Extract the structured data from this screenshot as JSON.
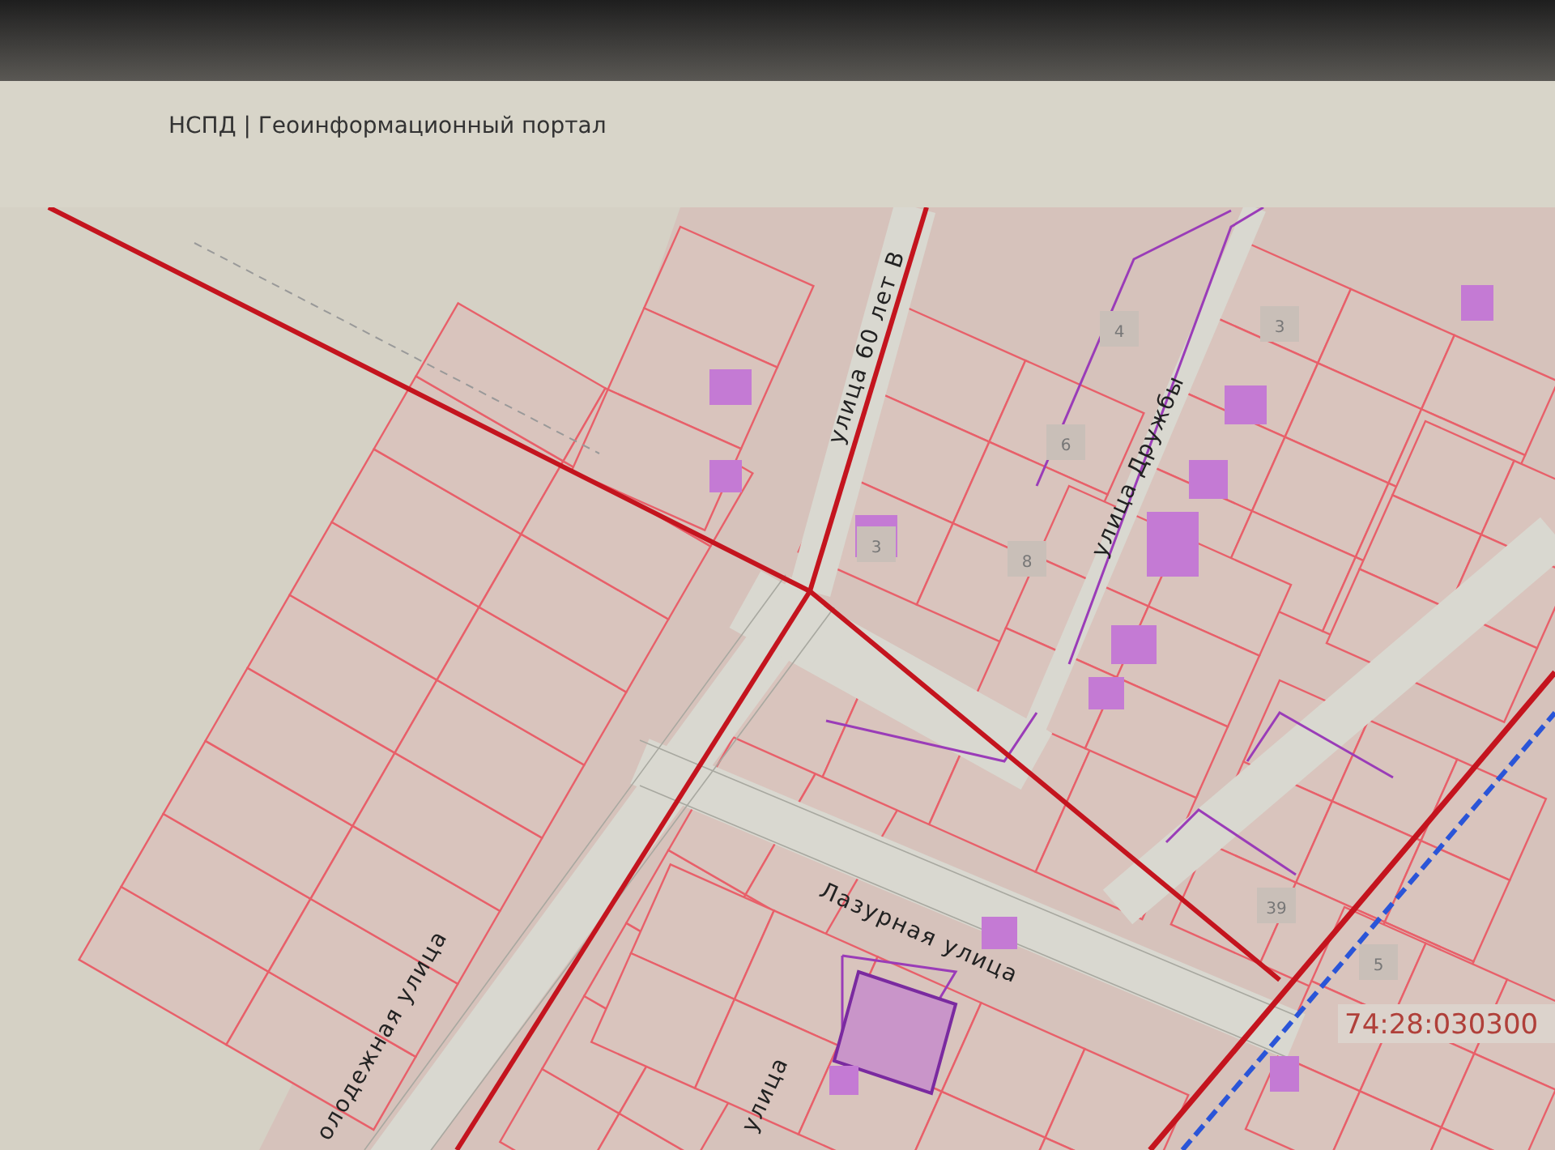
{
  "header": {
    "title": "НСПД | Геоинформационный портал"
  },
  "map": {
    "street_labels": [
      {
        "text": "улица 60 лет В"
      },
      {
        "text": "улица Дружбы"
      },
      {
        "text": "Лазурная улица"
      },
      {
        "text": "олодежная улица"
      },
      {
        "text": "улица"
      }
    ],
    "parcel_numbers": [
      {
        "text": "4"
      },
      {
        "text": "3"
      },
      {
        "text": "6"
      },
      {
        "text": "8"
      },
      {
        "text": "3"
      },
      {
        "text": "39"
      },
      {
        "text": "5"
      }
    ],
    "cadastral_number": "74:28:030300"
  }
}
